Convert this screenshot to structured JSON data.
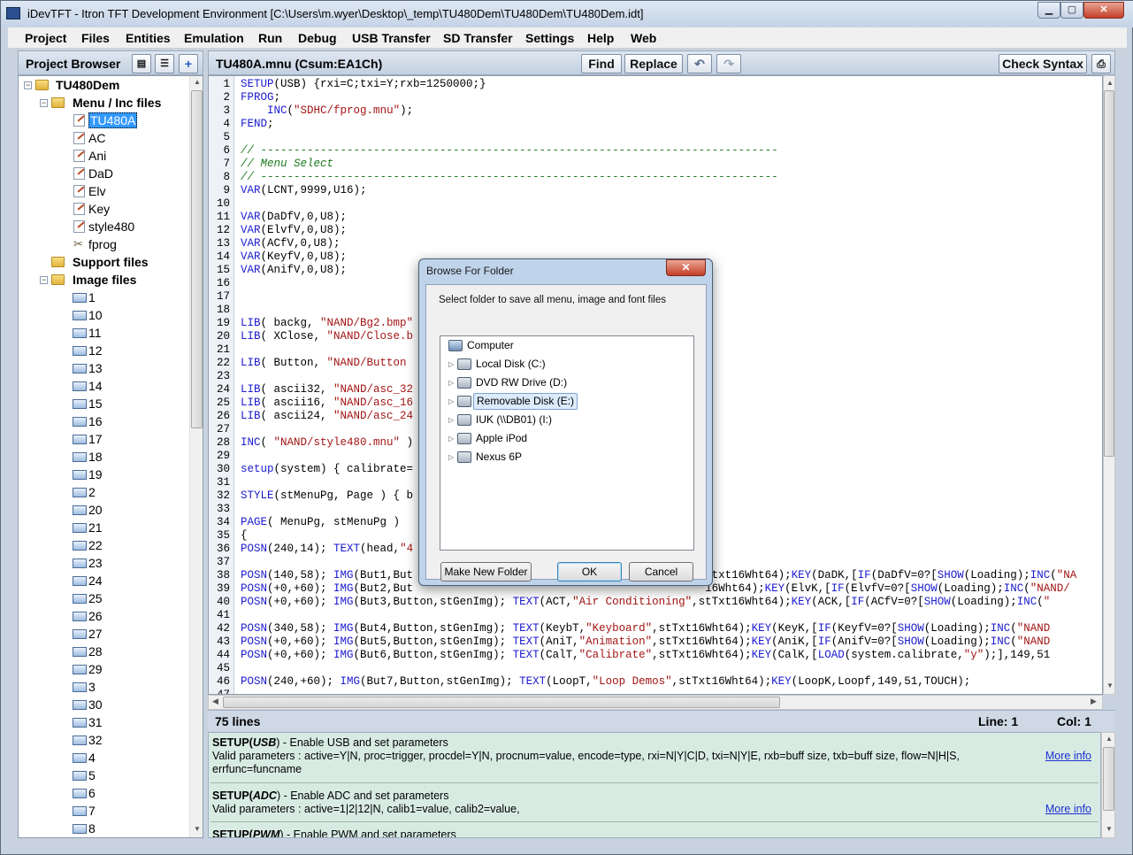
{
  "window": {
    "title": "iDevTFT - Itron TFT Development Environment  [C:\\Users\\m.wyer\\Desktop\\_temp\\TU480Dem\\TU480Dem\\TU480Dem.idt]",
    "min_label": "▁",
    "max_label": "▢",
    "close_label": "✕"
  },
  "menu": [
    "Project",
    "Files",
    "Entities",
    "Emulation",
    "Run",
    "Debug",
    "USB Transfer",
    "SD Transfer",
    "Settings",
    "Help",
    "Web"
  ],
  "browser": {
    "title": "Project Browser",
    "root": "TU480Dem",
    "menu_folder": "Menu / Inc files",
    "menu_files": [
      "TU480A",
      "AC",
      "Ani",
      "DaD",
      "Elv",
      "Key",
      "style480",
      "fprog"
    ],
    "support_folder": "Support files",
    "image_folder": "Image files",
    "image_files": [
      "1",
      "10",
      "11",
      "12",
      "13",
      "14",
      "15",
      "16",
      "17",
      "18",
      "19",
      "2",
      "20",
      "21",
      "22",
      "23",
      "24",
      "25",
      "26",
      "27",
      "28",
      "29",
      "3",
      "30",
      "31",
      "32",
      "4",
      "5",
      "6",
      "7",
      "8"
    ]
  },
  "editor": {
    "title": "TU480A.mnu  (Csum:EA1Ch)",
    "find_label": "Find",
    "replace_label": "Replace",
    "check_label": "Check Syntax",
    "lines": [
      {
        "n": "1",
        "t": "SETUP(USB) {rxi=C;txi=Y;rxb=1250000;}"
      },
      {
        "n": "2",
        "t": "FPROG;"
      },
      {
        "n": "3",
        "t": "    INC(\"SDHC/fprog.mnu\");"
      },
      {
        "n": "4",
        "t": "FEND;"
      },
      {
        "n": "5",
        "t": ""
      },
      {
        "n": "6",
        "t": "// ------------------------------------------------------------------------------"
      },
      {
        "n": "7",
        "t": "// Menu Select"
      },
      {
        "n": "8",
        "t": "// ------------------------------------------------------------------------------"
      },
      {
        "n": "9",
        "t": "VAR(LCNT,9999,U16);"
      },
      {
        "n": "10",
        "t": ""
      },
      {
        "n": "11",
        "t": "VAR(DaDfV,0,U8);"
      },
      {
        "n": "12",
        "t": "VAR(ElvfV,0,U8);"
      },
      {
        "n": "13",
        "t": "VAR(ACfV,0,U8);"
      },
      {
        "n": "14",
        "t": "VAR(KeyfV,0,U8);"
      },
      {
        "n": "15",
        "t": "VAR(AnifV,0,U8);"
      },
      {
        "n": "16",
        "t": ""
      },
      {
        "n": "17",
        "t": ""
      },
      {
        "n": "18",
        "t": ""
      },
      {
        "n": "19",
        "t": "LIB( backg, \"NAND/Bg2.bmp\""
      },
      {
        "n": "20",
        "t": "LIB( XClose, \"NAND/Close.b"
      },
      {
        "n": "21",
        "t": ""
      },
      {
        "n": "22",
        "t": "LIB( Button, \"NAND/Button"
      },
      {
        "n": "23",
        "t": ""
      },
      {
        "n": "24",
        "t": "LIB( ascii32, \"NAND/asc_32"
      },
      {
        "n": "25",
        "t": "LIB( ascii16, \"NAND/asc_16"
      },
      {
        "n": "26",
        "t": "LIB( ascii24, \"NAND/asc_24"
      },
      {
        "n": "27",
        "t": ""
      },
      {
        "n": "28",
        "t": "INC( \"NAND/style480.mnu\" )"
      },
      {
        "n": "29",
        "t": ""
      },
      {
        "n": "30",
        "t": "setup(system) { calibrate="
      },
      {
        "n": "31",
        "t": ""
      },
      {
        "n": "32",
        "t": "STYLE(stMenuPg, Page ) { b"
      },
      {
        "n": "33",
        "t": ""
      },
      {
        "n": "34",
        "t": "PAGE( MenuPg, stMenuPg )"
      },
      {
        "n": "35",
        "t": "{"
      },
      {
        "n": "36",
        "t": "POSN(240,14); TEXT(head,\"4"
      },
      {
        "n": "37",
        "t": ""
      },
      {
        "n": "38",
        "t": "POSN(140,58); IMG(But1,But                                             txt16Wht64);KEY(DaDK,[IF(DaDfV=0?[SHOW(Loading);INC(\"NA"
      },
      {
        "n": "39",
        "t": "POSN(+0,+60); IMG(But2,But                                            16Wht64);KEY(ElvK,[IF(ElvfV=0?[SHOW(Loading);INC(\"NAND/"
      },
      {
        "n": "40",
        "t": "POSN(+0,+60); IMG(But3,Button,stGenImg); TEXT(ACT,\"Air Conditioning\",stTxt16Wht64);KEY(ACK,[IF(ACfV=0?[SHOW(Loading);INC(\""
      },
      {
        "n": "41",
        "t": ""
      },
      {
        "n": "42",
        "t": "POSN(340,58); IMG(But4,Button,stGenImg); TEXT(KeybT,\"Keyboard\",stTxt16Wht64);KEY(KeyK,[IF(KeyfV=0?[SHOW(Loading);INC(\"NAND"
      },
      {
        "n": "43",
        "t": "POSN(+0,+60); IMG(But5,Button,stGenImg); TEXT(AniT,\"Animation\",stTxt16Wht64);KEY(AniK,[IF(AnifV=0?[SHOW(Loading);INC(\"NAND"
      },
      {
        "n": "44",
        "t": "POSN(+0,+60); IMG(But6,Button,stGenImg); TEXT(CalT,\"Calibrate\",stTxt16Wht64);KEY(CalK,[LOAD(system.calibrate,\"y\");],149,51"
      },
      {
        "n": "45",
        "t": ""
      },
      {
        "n": "46",
        "t": "POSN(240,+60); IMG(But7,Button,stGenImg); TEXT(LoopT,\"Loop Demos\",stTxt16Wht64);KEY(LoopK,Loopf,149,51,TOUCH);"
      },
      {
        "n": "47",
        "t": ""
      }
    ]
  },
  "status": {
    "lines": "75 lines",
    "line": "Line: 1",
    "col": "Col: 1"
  },
  "help": [
    {
      "head": "SETUP(",
      "cmd": "USB",
      "tail": ") - Enable USB and set parameters",
      "params": "Valid parameters : active=Y|N, proc=trigger, procdel=Y|N, procnum=value, encode=type, rxi=N|Y|C|D, txi=N|Y|E, rxb=buff size, txb=buff size, flow=N|H|S,",
      "params2": "errfunc=funcname",
      "more": "More info"
    },
    {
      "head": "SETUP(",
      "cmd": "ADC",
      "tail": ") - Enable ADC and set parameters",
      "params": "Valid parameters : active=1|2|12|N, calib1=value, calib2=value,",
      "params2": "",
      "more": "More info"
    },
    {
      "head": "SETUP(",
      "cmd": "PWM",
      "tail": ") - Enable PWM and set parameters",
      "params": "",
      "params2": "",
      "more": ""
    }
  ],
  "dialog": {
    "title": "Browse For Folder",
    "message": "Select folder to save all menu, image and font files",
    "root": "Computer",
    "items": [
      {
        "label": "Local Disk (C:)",
        "icon": "hard-disk-icon"
      },
      {
        "label": "DVD RW Drive (D:)",
        "icon": "dvd-drive-icon"
      },
      {
        "label": "Removable Disk (E:)",
        "icon": "removable-disk-icon"
      },
      {
        "label": "IUK (\\\\DB01) (I:)",
        "icon": "network-drive-icon"
      },
      {
        "label": "Apple iPod",
        "icon": "ipod-icon"
      },
      {
        "label": "Nexus 6P",
        "icon": "phone-icon"
      }
    ],
    "selected": "Removable Disk (E:)",
    "new_folder_label": "Make New Folder",
    "ok_label": "OK",
    "cancel_label": "Cancel"
  },
  "colors": {
    "keyword": "#1b1bd0",
    "string": "#a31515",
    "comment": "#1c7a1c",
    "help_bg": "#d8ebe3"
  }
}
